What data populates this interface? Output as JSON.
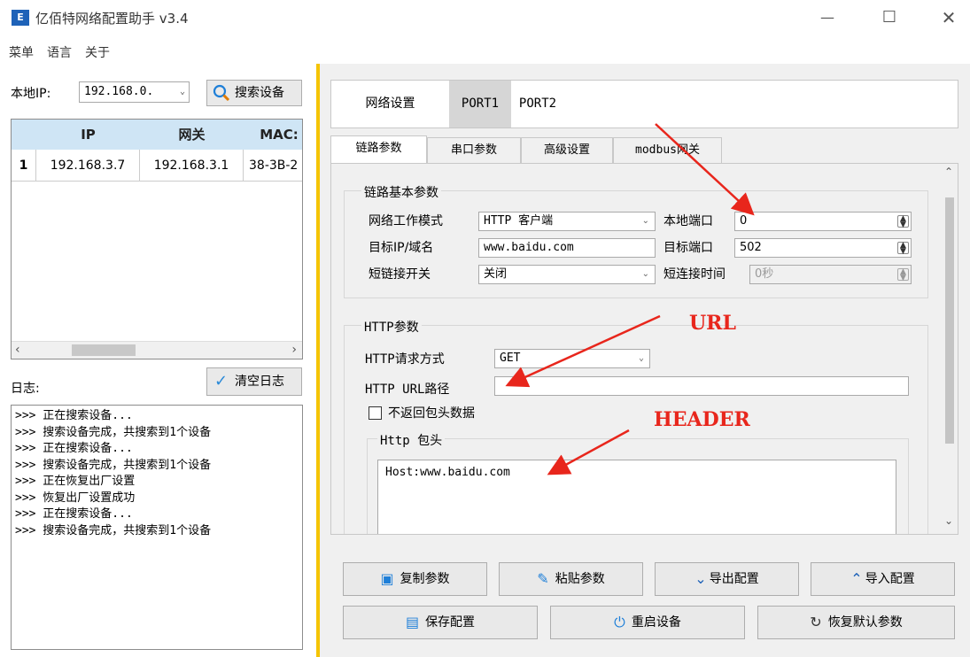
{
  "window": {
    "app_icon": "E",
    "title": "亿佰特网络配置助手 v3.4",
    "controls": [
      "minimize-icon",
      "maximize-icon",
      "close-icon"
    ]
  },
  "menu": [
    "菜单",
    "语言",
    "关于"
  ],
  "left": {
    "local_ip_label": "本地IP:",
    "local_ip_value": "192.168.0.",
    "search_button": "搜索设备",
    "table": {
      "headers": [
        "IP",
        "网关",
        "MAC:"
      ],
      "rows": [
        {
          "index": "1",
          "ip": "192.168.3.7",
          "gateway": "192.168.3.1",
          "mac": "38-3B-2"
        }
      ]
    },
    "log_label": "日志:",
    "clear_log_button": "清空日志",
    "log_lines": [
      ">>> 正在搜索设备...",
      ">>> 搜索设备完成，共搜索到1个设备",
      ">>> 正在搜索设备...",
      ">>> 搜索设备完成，共搜索到1个设备",
      ">>> 正在恢复出厂设置",
      ">>> 恢复出厂设置成功",
      ">>> 正在搜索设备...",
      ">>> 搜索设备完成，共搜索到1个设备"
    ]
  },
  "right": {
    "top_tabs": [
      "网络设置",
      "PORT1",
      "PORT2"
    ],
    "inner_tabs": [
      "链路参数",
      "串口参数",
      "高级设置",
      "modbus网关"
    ],
    "link_group": {
      "title": "链路基本参数",
      "work_mode_label": "网络工作模式",
      "work_mode_value": "HTTP 客户端",
      "local_port_label": "本地端口",
      "local_port_value": "0",
      "target_ip_label": "目标IP/域名",
      "target_ip_value": "www.baidu.com",
      "target_port_label": "目标端口",
      "target_port_value": "502",
      "short_conn_label": "短链接开关",
      "short_conn_value": "关闭",
      "short_conn_time_label": "短连接时间",
      "short_conn_time_value": "0秒"
    },
    "http_group": {
      "title": "HTTP参数",
      "method_label": "HTTP请求方式",
      "method_value": "GET",
      "url_label": "HTTP URL路径",
      "url_value": "",
      "no_header_label": "不返回包头数据",
      "header_group_title": "Http 包头",
      "header_value": "Host:www.baidu.com"
    },
    "buttons_row1": [
      {
        "label": "复制参数",
        "icon": "folder-icon"
      },
      {
        "label": "粘贴参数",
        "icon": "edit-icon"
      },
      {
        "label": "导出配置",
        "icon": "chevron-down-icon"
      },
      {
        "label": "导入配置",
        "icon": "chevron-up-icon"
      }
    ],
    "buttons_row2": [
      {
        "label": "保存配置",
        "icon": "save-icon"
      },
      {
        "label": "重启设备",
        "icon": "power-icon"
      },
      {
        "label": "恢复默认参数",
        "icon": "refresh-icon"
      }
    ]
  },
  "annotations": {
    "url": "URL",
    "header": "HEADER",
    "color": "#e8261c"
  }
}
